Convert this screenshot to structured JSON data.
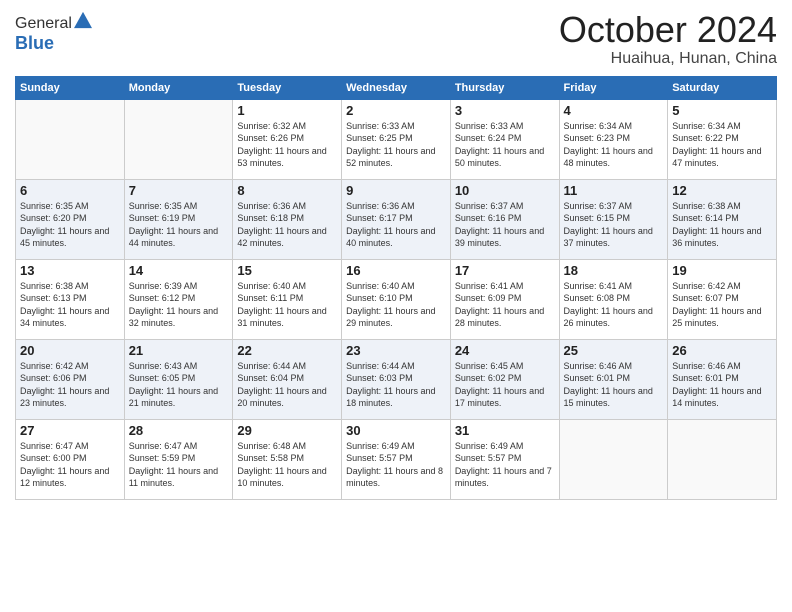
{
  "header": {
    "logo_general": "General",
    "logo_blue": "Blue",
    "month": "October 2024",
    "location": "Huaihua, Hunan, China"
  },
  "days_of_week": [
    "Sunday",
    "Monday",
    "Tuesday",
    "Wednesday",
    "Thursday",
    "Friday",
    "Saturday"
  ],
  "weeks": [
    [
      {
        "day": "",
        "sunrise": "",
        "sunset": "",
        "daylight": "",
        "empty": true
      },
      {
        "day": "",
        "sunrise": "",
        "sunset": "",
        "daylight": "",
        "empty": true
      },
      {
        "day": "1",
        "sunrise": "Sunrise: 6:32 AM",
        "sunset": "Sunset: 6:26 PM",
        "daylight": "Daylight: 11 hours and 53 minutes."
      },
      {
        "day": "2",
        "sunrise": "Sunrise: 6:33 AM",
        "sunset": "Sunset: 6:25 PM",
        "daylight": "Daylight: 11 hours and 52 minutes."
      },
      {
        "day": "3",
        "sunrise": "Sunrise: 6:33 AM",
        "sunset": "Sunset: 6:24 PM",
        "daylight": "Daylight: 11 hours and 50 minutes."
      },
      {
        "day": "4",
        "sunrise": "Sunrise: 6:34 AM",
        "sunset": "Sunset: 6:23 PM",
        "daylight": "Daylight: 11 hours and 48 minutes."
      },
      {
        "day": "5",
        "sunrise": "Sunrise: 6:34 AM",
        "sunset": "Sunset: 6:22 PM",
        "daylight": "Daylight: 11 hours and 47 minutes."
      }
    ],
    [
      {
        "day": "6",
        "sunrise": "Sunrise: 6:35 AM",
        "sunset": "Sunset: 6:20 PM",
        "daylight": "Daylight: 11 hours and 45 minutes."
      },
      {
        "day": "7",
        "sunrise": "Sunrise: 6:35 AM",
        "sunset": "Sunset: 6:19 PM",
        "daylight": "Daylight: 11 hours and 44 minutes."
      },
      {
        "day": "8",
        "sunrise": "Sunrise: 6:36 AM",
        "sunset": "Sunset: 6:18 PM",
        "daylight": "Daylight: 11 hours and 42 minutes."
      },
      {
        "day": "9",
        "sunrise": "Sunrise: 6:36 AM",
        "sunset": "Sunset: 6:17 PM",
        "daylight": "Daylight: 11 hours and 40 minutes."
      },
      {
        "day": "10",
        "sunrise": "Sunrise: 6:37 AM",
        "sunset": "Sunset: 6:16 PM",
        "daylight": "Daylight: 11 hours and 39 minutes."
      },
      {
        "day": "11",
        "sunrise": "Sunrise: 6:37 AM",
        "sunset": "Sunset: 6:15 PM",
        "daylight": "Daylight: 11 hours and 37 minutes."
      },
      {
        "day": "12",
        "sunrise": "Sunrise: 6:38 AM",
        "sunset": "Sunset: 6:14 PM",
        "daylight": "Daylight: 11 hours and 36 minutes."
      }
    ],
    [
      {
        "day": "13",
        "sunrise": "Sunrise: 6:38 AM",
        "sunset": "Sunset: 6:13 PM",
        "daylight": "Daylight: 11 hours and 34 minutes."
      },
      {
        "day": "14",
        "sunrise": "Sunrise: 6:39 AM",
        "sunset": "Sunset: 6:12 PM",
        "daylight": "Daylight: 11 hours and 32 minutes."
      },
      {
        "day": "15",
        "sunrise": "Sunrise: 6:40 AM",
        "sunset": "Sunset: 6:11 PM",
        "daylight": "Daylight: 11 hours and 31 minutes."
      },
      {
        "day": "16",
        "sunrise": "Sunrise: 6:40 AM",
        "sunset": "Sunset: 6:10 PM",
        "daylight": "Daylight: 11 hours and 29 minutes."
      },
      {
        "day": "17",
        "sunrise": "Sunrise: 6:41 AM",
        "sunset": "Sunset: 6:09 PM",
        "daylight": "Daylight: 11 hours and 28 minutes."
      },
      {
        "day": "18",
        "sunrise": "Sunrise: 6:41 AM",
        "sunset": "Sunset: 6:08 PM",
        "daylight": "Daylight: 11 hours and 26 minutes."
      },
      {
        "day": "19",
        "sunrise": "Sunrise: 6:42 AM",
        "sunset": "Sunset: 6:07 PM",
        "daylight": "Daylight: 11 hours and 25 minutes."
      }
    ],
    [
      {
        "day": "20",
        "sunrise": "Sunrise: 6:42 AM",
        "sunset": "Sunset: 6:06 PM",
        "daylight": "Daylight: 11 hours and 23 minutes."
      },
      {
        "day": "21",
        "sunrise": "Sunrise: 6:43 AM",
        "sunset": "Sunset: 6:05 PM",
        "daylight": "Daylight: 11 hours and 21 minutes."
      },
      {
        "day": "22",
        "sunrise": "Sunrise: 6:44 AM",
        "sunset": "Sunset: 6:04 PM",
        "daylight": "Daylight: 11 hours and 20 minutes."
      },
      {
        "day": "23",
        "sunrise": "Sunrise: 6:44 AM",
        "sunset": "Sunset: 6:03 PM",
        "daylight": "Daylight: 11 hours and 18 minutes."
      },
      {
        "day": "24",
        "sunrise": "Sunrise: 6:45 AM",
        "sunset": "Sunset: 6:02 PM",
        "daylight": "Daylight: 11 hours and 17 minutes."
      },
      {
        "day": "25",
        "sunrise": "Sunrise: 6:46 AM",
        "sunset": "Sunset: 6:01 PM",
        "daylight": "Daylight: 11 hours and 15 minutes."
      },
      {
        "day": "26",
        "sunrise": "Sunrise: 6:46 AM",
        "sunset": "Sunset: 6:01 PM",
        "daylight": "Daylight: 11 hours and 14 minutes."
      }
    ],
    [
      {
        "day": "27",
        "sunrise": "Sunrise: 6:47 AM",
        "sunset": "Sunset: 6:00 PM",
        "daylight": "Daylight: 11 hours and 12 minutes."
      },
      {
        "day": "28",
        "sunrise": "Sunrise: 6:47 AM",
        "sunset": "Sunset: 5:59 PM",
        "daylight": "Daylight: 11 hours and 11 minutes."
      },
      {
        "day": "29",
        "sunrise": "Sunrise: 6:48 AM",
        "sunset": "Sunset: 5:58 PM",
        "daylight": "Daylight: 11 hours and 10 minutes."
      },
      {
        "day": "30",
        "sunrise": "Sunrise: 6:49 AM",
        "sunset": "Sunset: 5:57 PM",
        "daylight": "Daylight: 11 hours and 8 minutes."
      },
      {
        "day": "31",
        "sunrise": "Sunrise: 6:49 AM",
        "sunset": "Sunset: 5:57 PM",
        "daylight": "Daylight: 11 hours and 7 minutes."
      },
      {
        "day": "",
        "sunrise": "",
        "sunset": "",
        "daylight": "",
        "empty": true
      },
      {
        "day": "",
        "sunrise": "",
        "sunset": "",
        "daylight": "",
        "empty": true
      }
    ]
  ]
}
